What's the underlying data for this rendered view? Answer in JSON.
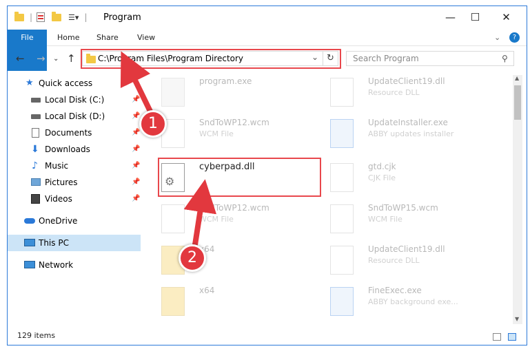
{
  "window": {
    "title": "Program",
    "minimize": "—",
    "maximize": "☐",
    "close": "✕"
  },
  "ribbon": {
    "tabs": [
      "File",
      "Home",
      "Share",
      "View"
    ],
    "help": "?"
  },
  "nav": {
    "address": "C:\\Program Files\\Program Directory",
    "search_placeholder": "Search Program"
  },
  "sidebar": {
    "items": [
      {
        "label": "Quick access",
        "icon": "star-icon"
      },
      {
        "label": "Local Disk (C:)",
        "icon": "drive-icon",
        "pinned": true
      },
      {
        "label": "Local Disk (D:)",
        "icon": "drive-icon",
        "pinned": true
      },
      {
        "label": "Documents",
        "icon": "documents-icon",
        "pinned": true
      },
      {
        "label": "Downloads",
        "icon": "download-icon",
        "pinned": true
      },
      {
        "label": "Music",
        "icon": "music-icon",
        "pinned": true
      },
      {
        "label": "Pictures",
        "icon": "pictures-icon",
        "pinned": true
      },
      {
        "label": "Videos",
        "icon": "videos-icon",
        "pinned": true
      },
      {
        "label": "OneDrive",
        "icon": "cloud-icon"
      },
      {
        "label": "This PC",
        "icon": "computer-icon",
        "selected": true
      },
      {
        "label": "Network",
        "icon": "network-icon"
      }
    ]
  },
  "files": [
    {
      "name": "program.exe",
      "type": ""
    },
    {
      "name": "UpdateClient19.dll",
      "type": "Resource DLL"
    },
    {
      "name": "SndToWP12.wcm",
      "type": "WCM File"
    },
    {
      "name": "UpdateInstaller.exe",
      "type": "ABBY updates installer"
    },
    {
      "name": "cyberpad.dll",
      "type": ""
    },
    {
      "name": "gtd.cjk",
      "type": "CJK File"
    },
    {
      "name": "SndToWP12.wcm",
      "type": "WCM File"
    },
    {
      "name": "SndToWP15.wcm",
      "type": "WCM File"
    },
    {
      "name": "x64",
      "type": ""
    },
    {
      "name": "UpdateClient19.dll",
      "type": "Resource DLL"
    },
    {
      "name": "x64",
      "type": ""
    },
    {
      "name": "FineExec.exe",
      "type": "ABBY background exe..."
    }
  ],
  "status": {
    "item_count": "129 items"
  },
  "annotations": {
    "step1": "1",
    "step2": "2",
    "color": "#e2383e"
  },
  "colors": {
    "accent": "#1979ca",
    "highlight": "#e8474c",
    "selected": "#cce4f7"
  }
}
